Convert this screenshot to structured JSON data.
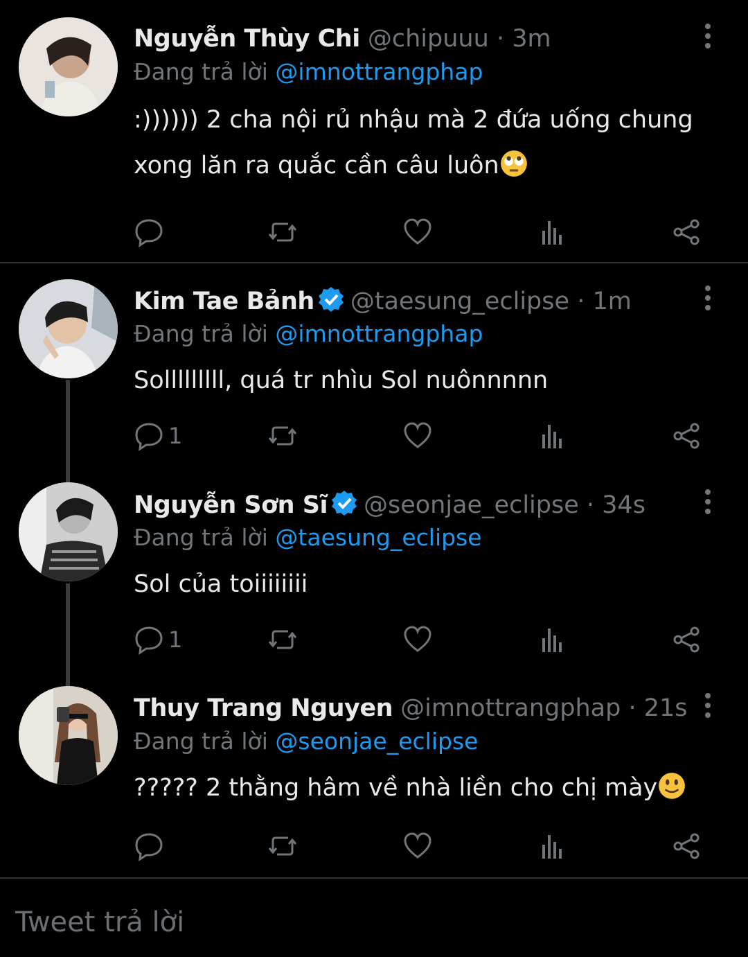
{
  "reply_prefix": "Đang trả lời",
  "tweets": [
    {
      "name": "Nguyễn Thùy Chi",
      "handle": "@chipuuu",
      "time": "· 3m",
      "verified": false,
      "reply_to": "@imnottrangphap",
      "text_lines": [
        ":)))))) 2 cha nội rủ nhậu mà 2 đứa uống chung",
        "xong lăn ra quắc cần câu luôn"
      ],
      "emoji": "eye-roll-emoji",
      "reply_count": ""
    },
    {
      "name": "Kim Tae Bảnh",
      "handle": "@taesung_eclipse",
      "time": "· 1m",
      "verified": true,
      "reply_to": "@imnottrangphap",
      "text_lines": [
        "Solllllllll, quá tr nhìu Sol nuônnnnn"
      ],
      "reply_count": "1"
    },
    {
      "name": "Nguyễn Sơn Sĩ",
      "handle": "@seonjae_eclipse",
      "time": "· 34s",
      "verified": true,
      "reply_to": "@taesung_eclipse",
      "text_lines": [
        "Sol của toiiiiiiii"
      ],
      "reply_count": "1"
    },
    {
      "name": "Thuy Trang Nguyen",
      "handle": "@imnottrangphap",
      "time": "· 21s",
      "verified": false,
      "reply_to": "@seonjae_eclipse",
      "text_lines": [
        "????? 2 thằng hâm về nhà liền cho chị mày"
      ],
      "emoji": "slight-smile-emoji",
      "reply_count": ""
    }
  ],
  "composer_placeholder": "Tweet trả lời",
  "colors": {
    "background": "#000000",
    "text": "#e7e9ea",
    "muted": "#71767b",
    "accent": "#1d9bf0"
  }
}
